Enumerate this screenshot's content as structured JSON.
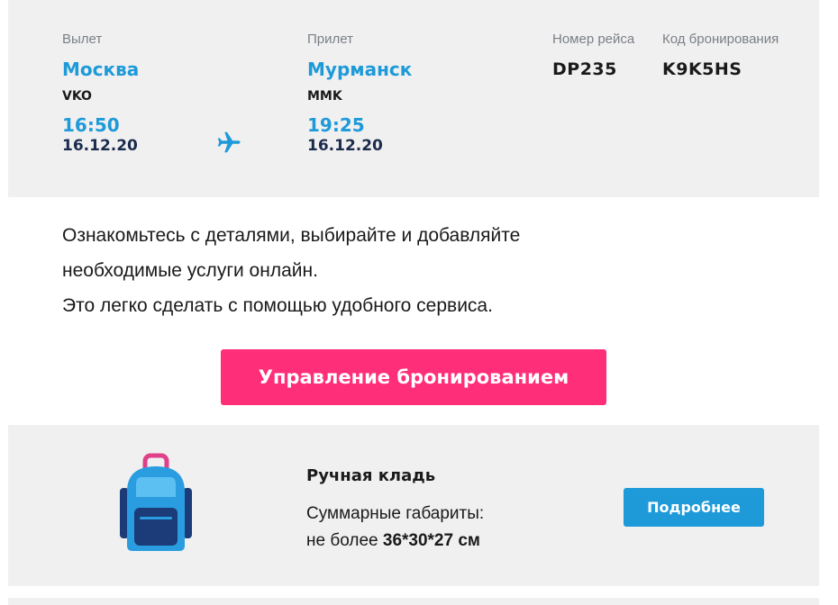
{
  "flight": {
    "departure_label": "Вылет",
    "departure_city": "Москва",
    "departure_iata": "VKO",
    "departure_time": "16:50",
    "departure_date": "16.12.20",
    "arrival_label": "Прилет",
    "arrival_city": "Мурманск",
    "arrival_iata": "MMK",
    "arrival_time": "19:25",
    "arrival_date": "16.12.20",
    "flight_number_label": "Номер рейса",
    "flight_number": "DP235",
    "booking_code_label": "Код бронирования",
    "booking_code": "K9K5HS",
    "plane_icon": "airplane-icon"
  },
  "intro": {
    "line1": "Ознакомьтесь с деталями, выбирайте и добавляйте",
    "line2": "необходимые услуги онлайн.",
    "line3": "Это легко сделать с помощью удобного сервиса."
  },
  "manage_button": {
    "label": "Управление бронированием"
  },
  "baggage": {
    "icon": "backpack-icon",
    "title": "Ручная кладь",
    "dimensions_label": "Суммарные габариты:",
    "dimensions_prefix": "не более",
    "dimensions_value": "36*30*27 см",
    "details_button": "Подробнее"
  },
  "colors": {
    "accent_blue": "#1e9ad9",
    "accent_pink": "#ff2e78",
    "card_bg": "#f0f0f0",
    "date_navy": "#1b2b4d"
  }
}
